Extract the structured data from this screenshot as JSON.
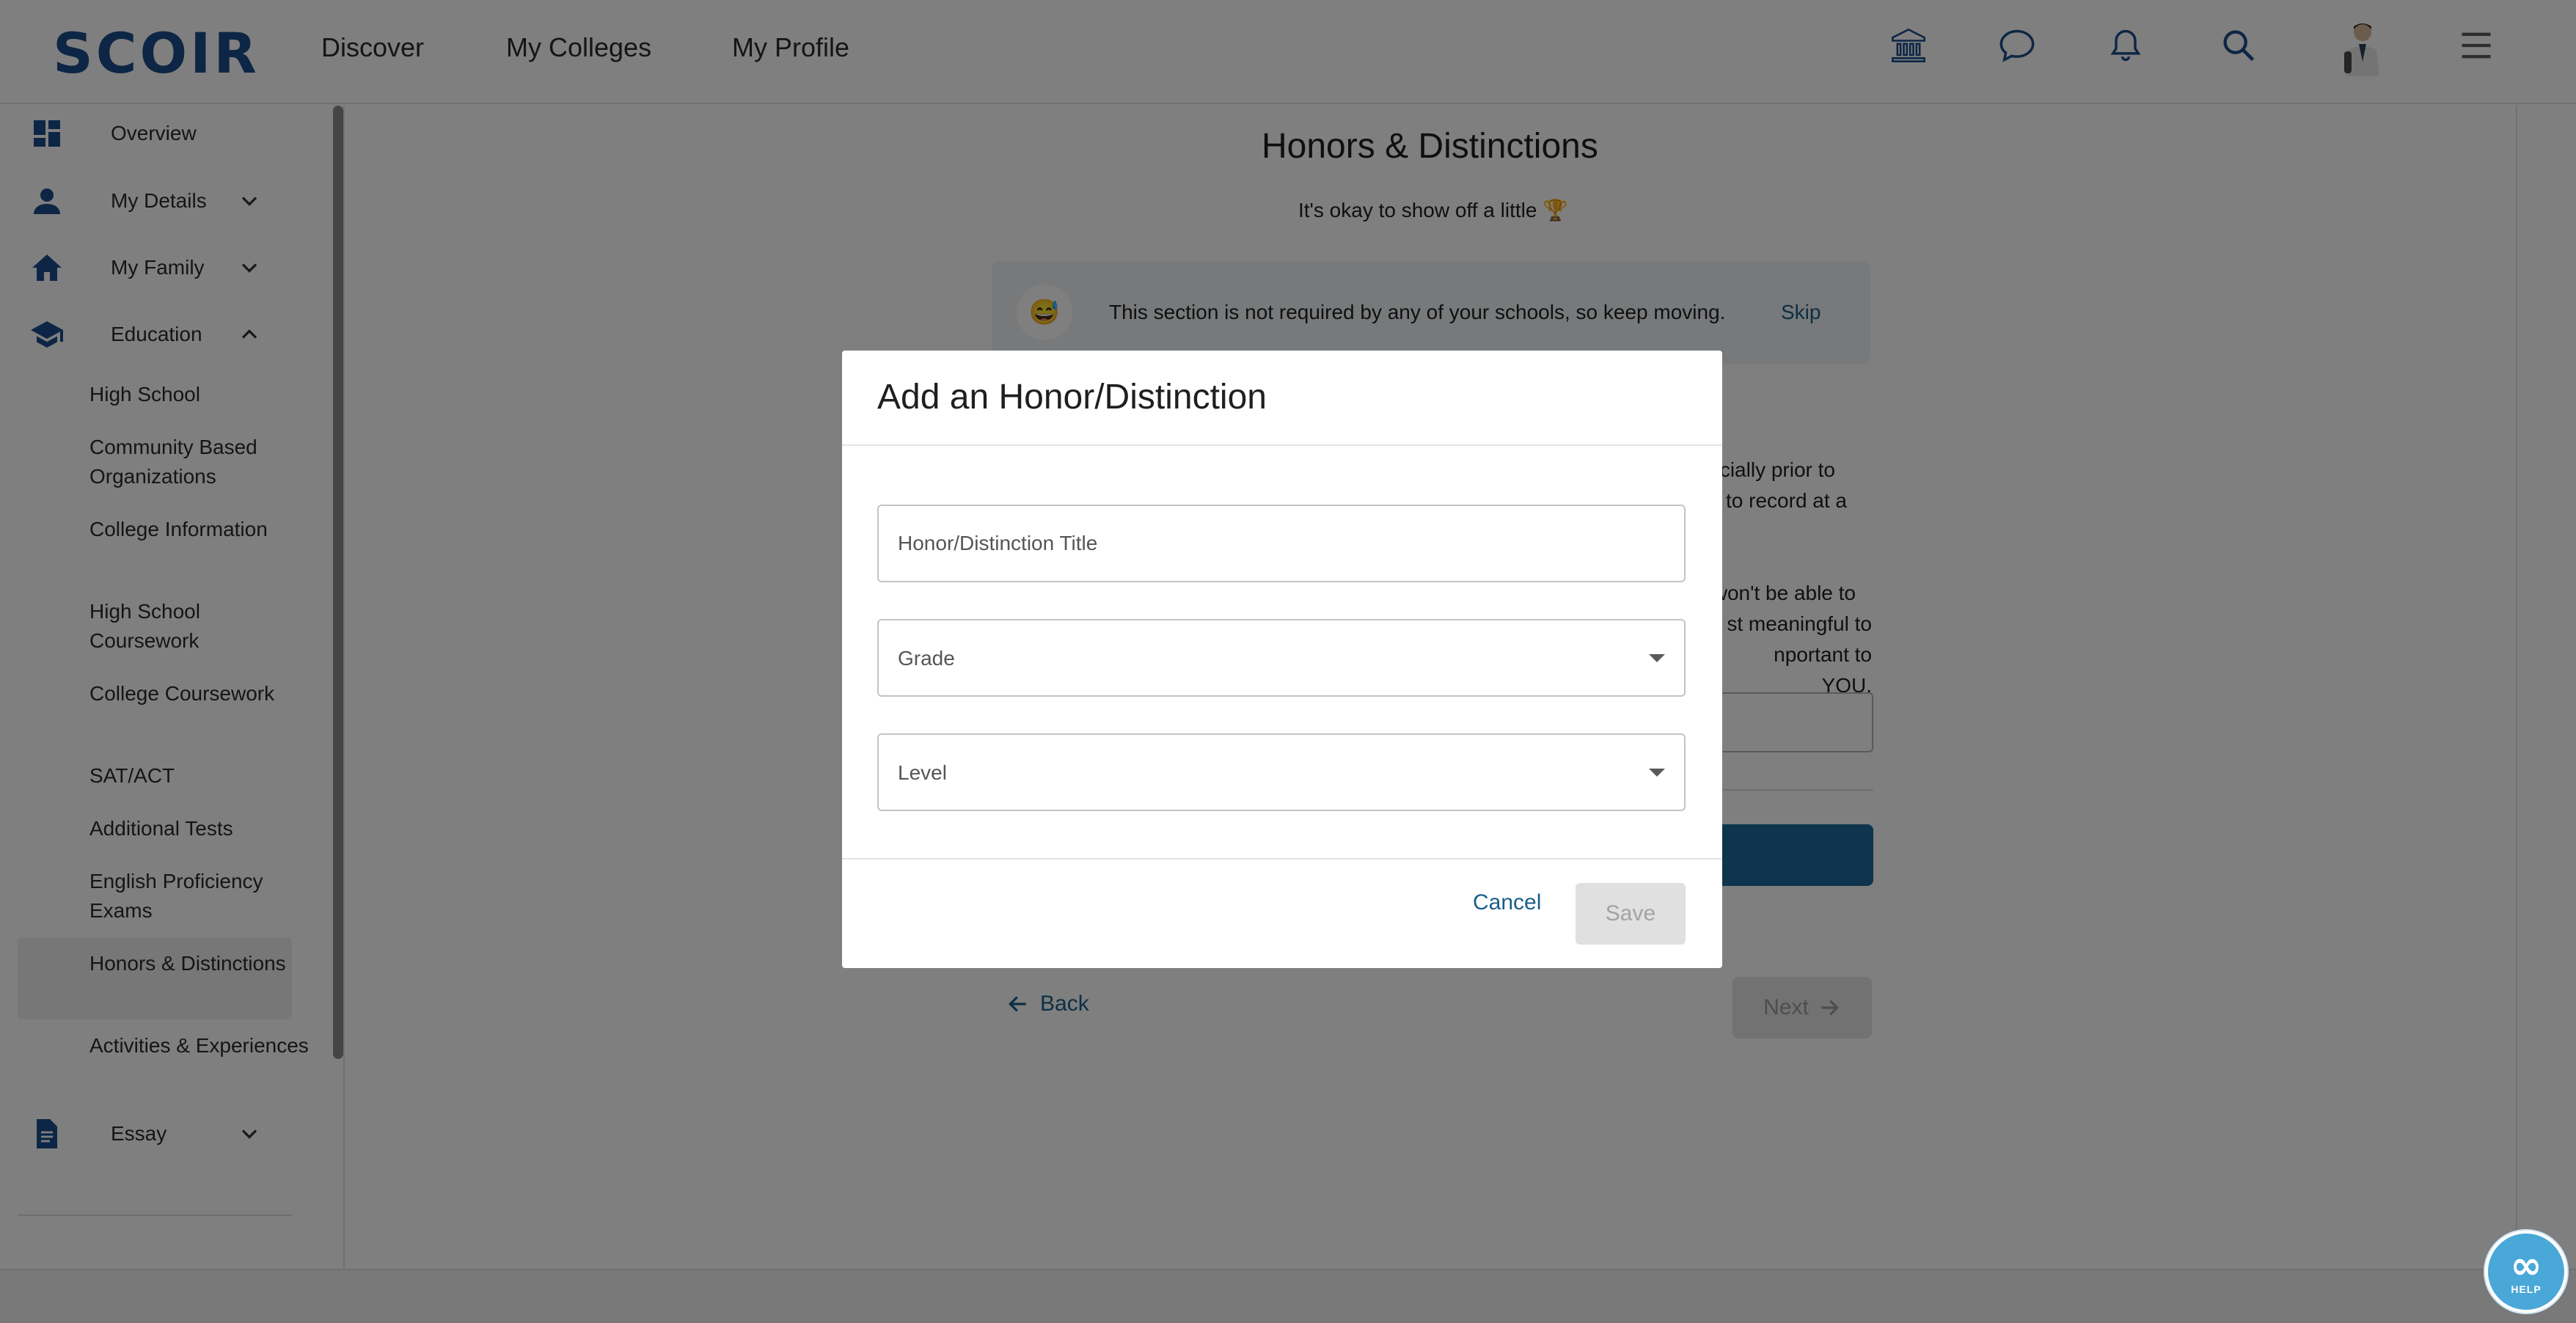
{
  "header": {
    "logo_text": "SCOIR",
    "nav": [
      "Discover",
      "My Colleges",
      "My Profile"
    ],
    "icons": [
      "institution-icon",
      "chat-icon",
      "bell-icon",
      "search-icon",
      "avatar",
      "menu-icon"
    ]
  },
  "sidebar": {
    "items": [
      {
        "label": "Overview",
        "icon": "dashboard-icon"
      },
      {
        "label": "My Details",
        "icon": "person-icon",
        "expandable": true,
        "expanded": false
      },
      {
        "label": "My Family",
        "icon": "home-icon",
        "expandable": true,
        "expanded": false
      },
      {
        "label": "Education",
        "icon": "graduation-cap-icon",
        "expandable": true,
        "expanded": true
      },
      {
        "label": "Essay",
        "icon": "document-icon",
        "expandable": true,
        "expanded": false
      }
    ],
    "education_sub": [
      "High School",
      "Community Based Organizations",
      "College Information",
      "High School Coursework",
      "College Coursework",
      "SAT/ACT",
      "Additional Tests",
      "English Proficiency Exams",
      "Honors & Distinctions",
      "Activities & Experiences"
    ],
    "active_sub": "Honors & Distinctions"
  },
  "page": {
    "title": "Honors & Distinctions",
    "subtitle": "It's okay to show off a little 🏆",
    "info_emoji": "😅",
    "info_text": "This section is not required by any of your schools, so keep moving.",
    "skip_label": "Skip",
    "fragments": [
      "cially prior to",
      "to record at a",
      "won't be able to",
      "st meaningful to",
      "nportant to YOU."
    ],
    "back_label": "Back",
    "next_label": "Next"
  },
  "modal": {
    "title": "Add an Honor/Distinction",
    "title_placeholder": "Honor/Distinction Title",
    "grade_label": "Grade",
    "level_label": "Level",
    "cancel_label": "Cancel",
    "save_label": "Save",
    "save_enabled": false
  },
  "help": {
    "label": "HELP"
  },
  "colors": {
    "brand": "#1a4d8a",
    "link": "#1a5e8a",
    "primary_button": "#1d6b9a",
    "help_button": "#4aa8d8"
  }
}
